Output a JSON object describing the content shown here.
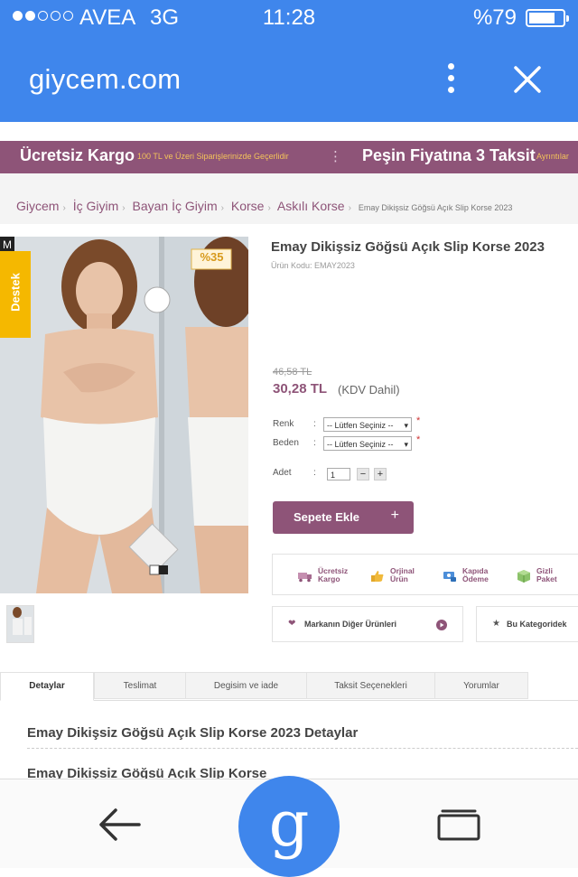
{
  "status_bar": {
    "carrier": "AVEA",
    "network": "3G",
    "time": "11:28",
    "battery_text": "%79",
    "battery_level": 0.79,
    "signal_bars_filled": 2,
    "signal_bars_total": 5
  },
  "browser": {
    "url": "giycem.com"
  },
  "promo": {
    "free_shipping": "Ücretsiz Kargo",
    "free_shipping_sub": "100 TL ve Üzeri Siparişlerinizde Geçerlidir",
    "installments": "Peşin Fiyatına 3 Taksit",
    "installments_sub": "Ayrıntılar"
  },
  "breadcrumb": [
    "Giycem",
    "İç Giyim",
    "Bayan İç Giyim",
    "Korse",
    "Askılı Korse",
    "Emay Dikişsiz Göğsü Açık Slip Korse 2023"
  ],
  "support_tab": "Destek",
  "photo": {
    "discount_badge": "%35",
    "brand_mark": "M"
  },
  "product": {
    "title": "Emay Dikişsiz Göğsü Açık Slip Korse 2023",
    "code": "Ürün Kodu: EMAY2023",
    "old_price": "46,58 TL",
    "price": "30,28 TL",
    "vat_note": "(KDV Dahil)",
    "color_label": "Renk",
    "size_label": "Beden",
    "qty_label": "Adet",
    "select_placeholder": "-- Lütfen Seçiniz --",
    "quantity": "1",
    "add_to_cart": "Sepete Ekle",
    "plus_symbol": "+",
    "minus_symbol": "−",
    "required_mark": "*"
  },
  "badges": [
    {
      "line1": "Ücretsiz",
      "line2": "Kargo",
      "icon": "truck-icon"
    },
    {
      "line1": "Orjinal",
      "line2": "Ürün",
      "icon": "thumbs-up-icon"
    },
    {
      "line1": "Kapıda",
      "line2": "Ödeme",
      "icon": "cash-icon"
    },
    {
      "line1": "Gizli",
      "line2": "Paket",
      "icon": "package-icon"
    }
  ],
  "links": {
    "brand_other": "Markanın Diğer Ürünleri",
    "category": "Bu Kategoridek"
  },
  "tabs": [
    "Detaylar",
    "Teslimat",
    "Degisim ve iade",
    "Taksit Seçenekleri",
    "Yorumlar"
  ],
  "details": {
    "title": "Emay Dikişsiz Göğsü Açık Slip Korse 2023 Detaylar",
    "subtitle": "Emay Dikişsiz Göğsü Açık Slip Korse"
  },
  "bottom_bar": {
    "google_letter": "g"
  },
  "colors": {
    "browser_blue": "#3f86ec",
    "brand_purple": "#8e5478",
    "support_yellow": "#f5b800"
  }
}
